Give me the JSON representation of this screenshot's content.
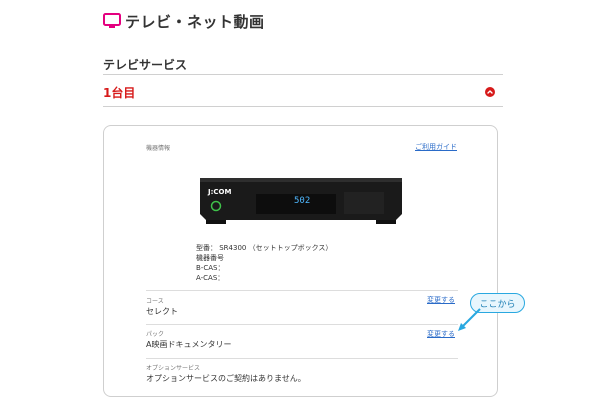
{
  "header": {
    "title": "テレビ・ネット動画",
    "icon": "tv-icon",
    "accent_color": "#e4007f"
  },
  "section": {
    "title": "テレビサービス"
  },
  "unit": {
    "label": "1台目",
    "toggle_icon": "chevron-up-icon",
    "color": "#d71a1a"
  },
  "device": {
    "section_label": "機器情報",
    "guide_link": "ご利用ガイド",
    "stb_brand": "J:COM",
    "stb_display": "502",
    "model": "型番： SR4300 （セットトップボックス）",
    "serial": "機器番号",
    "bcas": "B-CAS：",
    "acas": "A-CAS："
  },
  "course": {
    "label": "コース",
    "value": "セレクト",
    "change_link": "変更する"
  },
  "pack": {
    "label": "パック",
    "value": "A映画ドキュメンタリー",
    "change_link": "変更する"
  },
  "options": {
    "label": "オプションサービス",
    "value": "オプションサービスのご契約はありません。"
  },
  "callout": {
    "text": "ここから",
    "color": "#29a8e0"
  }
}
